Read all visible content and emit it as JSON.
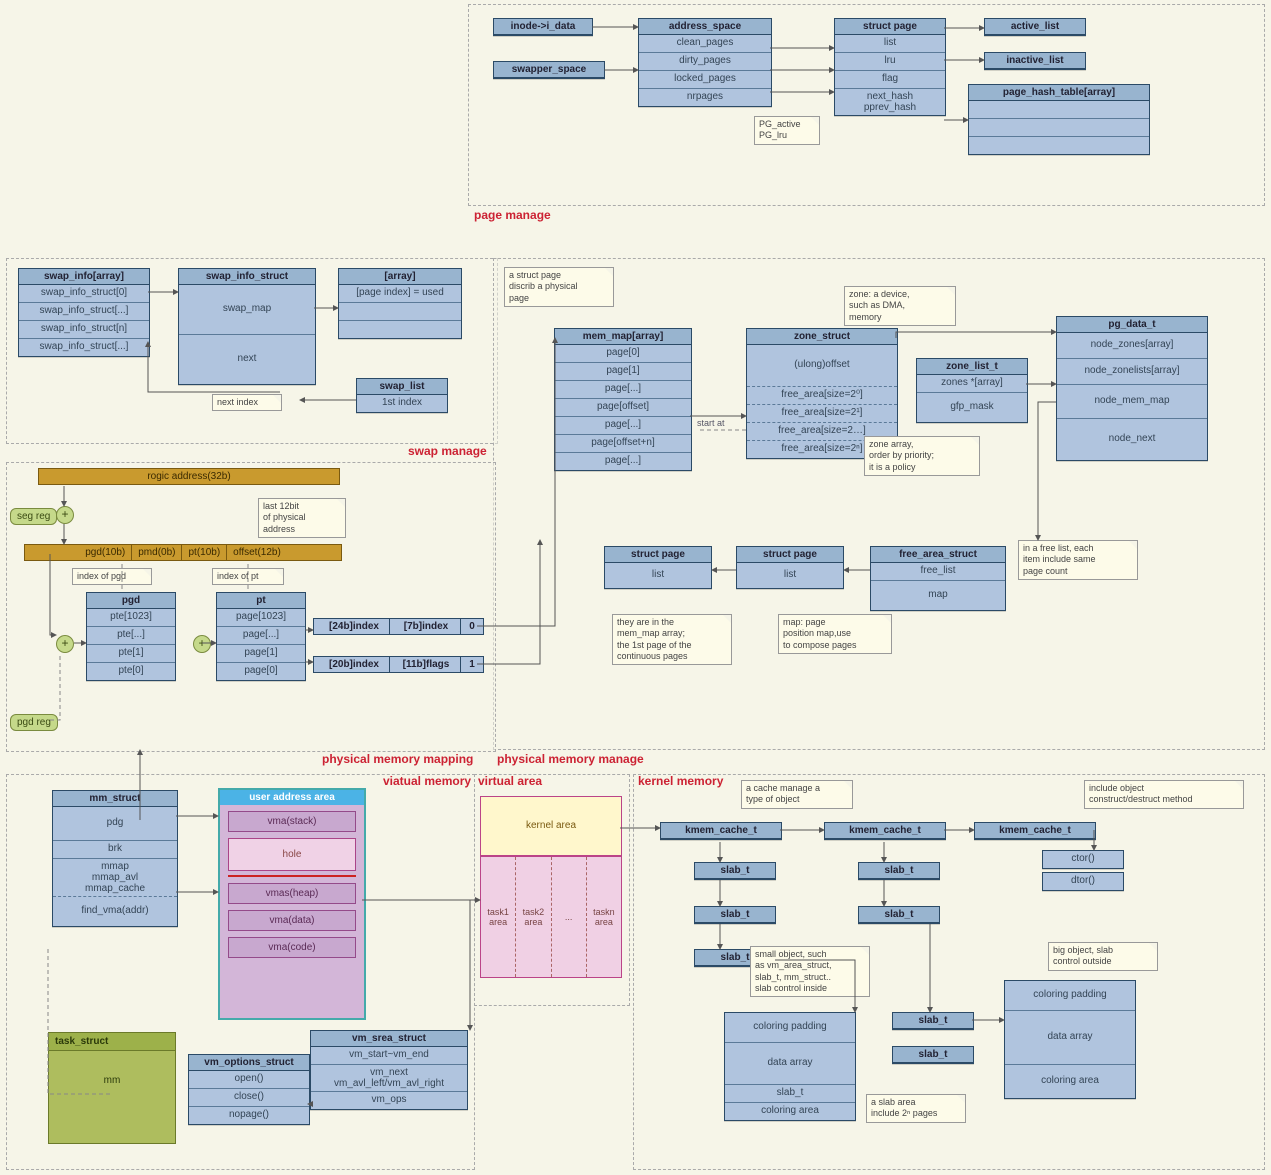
{
  "regions": {
    "page_manage": "page manage",
    "swap_manage": "swap manage",
    "phys_mapping": "physical memory mapping",
    "phys_manage": "physical memory manage",
    "virtual_memory": "viatual memory",
    "virtual_area": "virtual area",
    "kernel_memory": "kernel memory"
  },
  "page_manage": {
    "inode": "inode->i_data",
    "swapper_space": "swapper_space",
    "address_space": {
      "title": "address_space",
      "rows": [
        "clean_pages",
        "dirty_pages",
        "locked_pages",
        "nrpages"
      ]
    },
    "struct_page": {
      "title": "struct page",
      "rows": [
        "list",
        "lru",
        "flag",
        "next_hash\npprev_hash"
      ]
    },
    "pg_note": "PG_active\nPG_lru",
    "active_list": "active_list",
    "inactive_list": "inactive_list",
    "page_hash_table": {
      "title": "page_hash_table[array]",
      "rows": [
        "",
        "",
        ""
      ]
    }
  },
  "swap": {
    "swap_info_array": {
      "title": "swap_info[array]",
      "rows": [
        "swap_info_struct[0]",
        "swap_info_struct[...]",
        "swap_info_struct[n]",
        "swap_info_struct[...]"
      ]
    },
    "swap_info_struct": {
      "title": "swap_info_struct",
      "rows": [
        "swap_map",
        "next"
      ]
    },
    "array": {
      "title": "[array]",
      "rows": [
        "[page index] = used",
        "",
        ""
      ]
    },
    "swap_list": {
      "title": "swap_list",
      "rows": [
        "1st index"
      ]
    },
    "next_index_note": "next index"
  },
  "phys_mapping": {
    "ropic": "rogic address(32b)",
    "seg_reg": "seg reg",
    "pgd_reg": "pgd reg",
    "last12_note": "last 12bit\nof physical\naddress",
    "segments": [
      "pgd(10b)",
      "pmd(0b)",
      "pt(10b)",
      "offset(12b)"
    ],
    "idx_pgd": "index of pgd",
    "idx_pt": "index of pt",
    "pgd": {
      "title": "pgd",
      "rows": [
        "pte[1023]",
        "pte[...]",
        "pte[1]",
        "pte[0]"
      ]
    },
    "pt": {
      "title": "pt",
      "rows": [
        "page[1023]",
        "page[...]",
        "page[1]",
        "page[0]"
      ]
    },
    "row_a": [
      "[24b]index",
      "[7b]index",
      "0"
    ],
    "row_b": [
      "[20b]index",
      "[11b]flags",
      "1"
    ]
  },
  "phys_manage": {
    "note1": "a struct page\ndiscrib a physical\npage",
    "mem_map": {
      "title": "mem_map[array]",
      "rows": [
        "page[0]",
        "page[1]",
        "page[...]",
        "page[offset]",
        "page[...]",
        "page[offset+n]",
        "page[...]"
      ]
    },
    "zone_struct": {
      "title": "zone_struct",
      "rows": [
        "(ulong)offset",
        "free_area[size=2⁰]",
        "free_area[size=2¹]",
        "free_area[size=2…]",
        "free_area[size=2ⁿ]"
      ]
    },
    "zone_note": "zone: a device,\nsuch as DMA,\nmemory",
    "zone_list_t": {
      "title": "zone_list_t",
      "rows": [
        "zones *[array]",
        "gfp_mask"
      ]
    },
    "zone_list_note": "zone array,\norder by priority;\nit is a policy",
    "pg_data_t": {
      "title": "pg_data_t",
      "rows": [
        "node_zones[array]",
        "node_zonelists[array]",
        "node_mem_map",
        "node_next"
      ]
    },
    "struct_page_l": {
      "title": "struct page",
      "rows": [
        "list"
      ]
    },
    "struct_page_r": {
      "title": "struct page",
      "rows": [
        "list"
      ]
    },
    "free_area_struct": {
      "title": "free_area_struct",
      "rows": [
        "free_list",
        "map"
      ]
    },
    "free_list_note": "in a free list, each\nitem include same\npage count",
    "note2": "they are in the\nmem_map array;\nthe 1st page of the\ncontinuous pages",
    "note3": "map: page\nposition map,use\nto compose pages",
    "start_at": "start at"
  },
  "virtual_memory": {
    "mm_struct": {
      "title": "mm_struct",
      "rows": [
        "pdg",
        "brk",
        "mmap\nmmap_avl\nmmap_cache",
        "find_vma(addr)"
      ]
    },
    "user_area_title": "user address area",
    "slots": [
      "vma(stack)",
      "hole",
      "vmas(heap)",
      "vma(data)",
      "vma(code)"
    ],
    "vm_srea_struct": {
      "title": "vm_srea_struct",
      "rows": [
        "vm_start~vm_end",
        "vm_next\nvm_avl_left/vm_avl_right",
        "vm_ops"
      ]
    },
    "vm_options_struct": {
      "title": "vm_options_struct",
      "rows": [
        "open()",
        "close()",
        "nopage()"
      ]
    },
    "task_struct": {
      "title": "task_struct",
      "row": "mm"
    }
  },
  "virtual_area": {
    "kernel_area": "kernel area",
    "cols": [
      "task1\narea",
      "task2\narea",
      "...",
      "taskn\narea"
    ]
  },
  "kernel_memory": {
    "cache_note": "a cache manage a\ntype of object",
    "ctor_note": "include object\nconstruct/destruct method",
    "kmem_cache_t": "kmem_cache_t",
    "slab_t": "slab_t",
    "ctor": "ctor()",
    "dtor": "dtor()",
    "small_note": "small object, such\nas vm_area_struct,\nslab_t, mm_struct..\nslab control inside",
    "big_note": "big object, slab\ncontrol outside",
    "slab_box_a": {
      "title": "",
      "rows": [
        "coloring padding",
        "data array",
        "slab_t",
        "coloring area"
      ]
    },
    "slab_box_b": {
      "title": "",
      "rows": [
        "coloring padding",
        "data array",
        "coloring area"
      ]
    },
    "slab_area_note": "a slab area\ninclude 2ⁿ pages"
  }
}
